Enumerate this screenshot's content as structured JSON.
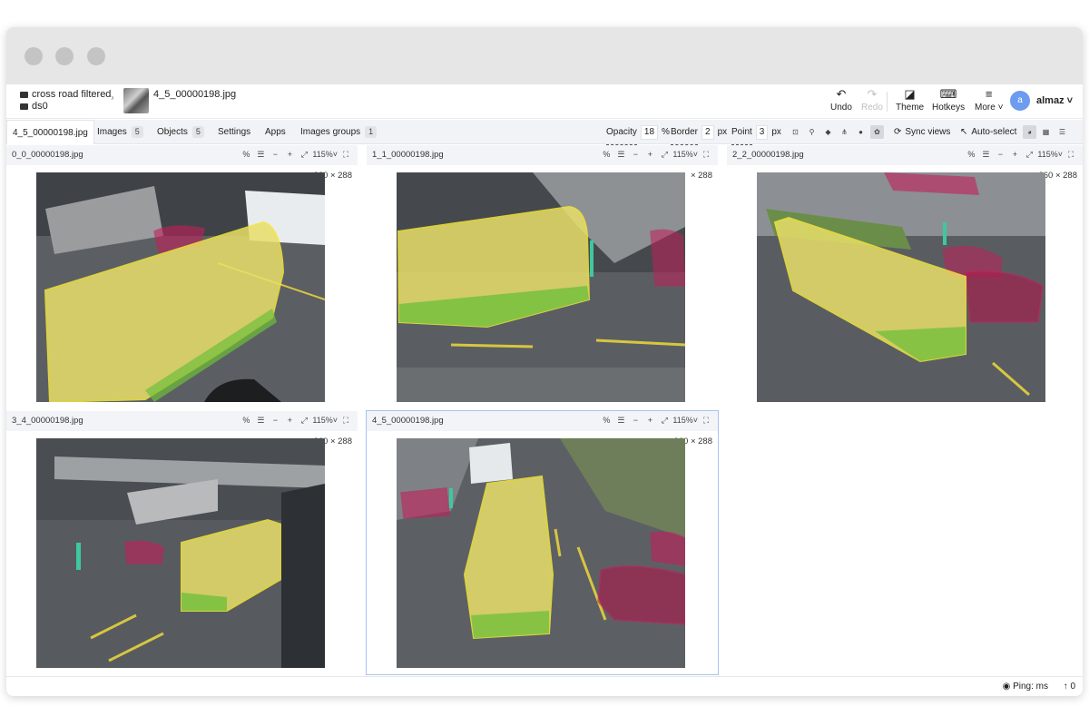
{
  "breadcrumb": {
    "project": "cross road filtered",
    "dataset": "ds0",
    "image_name": "4_5_00000198.jpg"
  },
  "toolbar": {
    "undo_label": "Undo",
    "redo_label": "Redo",
    "theme_label": "Theme",
    "hotkeys_label": "Hotkeys",
    "more_label": "More"
  },
  "user": {
    "initial": "a",
    "name": "almaz"
  },
  "tabs": {
    "current_file": "4_5_00000198.jpg",
    "images_label": "Images",
    "images_count": "5",
    "objects_label": "Objects",
    "objects_count": "5",
    "settings_label": "Settings",
    "apps_label": "Apps",
    "image_groups_label": "Images groups",
    "image_groups_count": "1"
  },
  "view_controls": {
    "opacity_label": "Opacity",
    "opacity_value": "18",
    "opacity_unit": "%",
    "border_label": "Border",
    "border_value": "2",
    "border_unit": "px",
    "point_label": "Point",
    "point_value": "3",
    "point_unit": "px",
    "sync_views_label": "Sync views",
    "auto_select_label": "Auto-select"
  },
  "panes": [
    {
      "name": "0_0_00000198.jpg",
      "zoom": "115%",
      "size": "360 × 288"
    },
    {
      "name": "1_1_00000198.jpg",
      "zoom": "115%",
      "size": "× 288"
    },
    {
      "name": "2_2_00000198.jpg",
      "zoom": "115%",
      "size": "360 × 288"
    },
    {
      "name": "3_4_00000198.jpg",
      "zoom": "115%",
      "size": "360 × 288"
    },
    {
      "name": "4_5_00000198.jpg",
      "zoom": "115%",
      "size": "360 × 288"
    }
  ],
  "footer": {
    "ping": "Ping: ms",
    "uploads": "0"
  },
  "colors": {
    "bus": "#f0e46a",
    "car": "#c2205a",
    "person": "#3fc7a0",
    "bus_stripe": "#6fbf3a"
  }
}
